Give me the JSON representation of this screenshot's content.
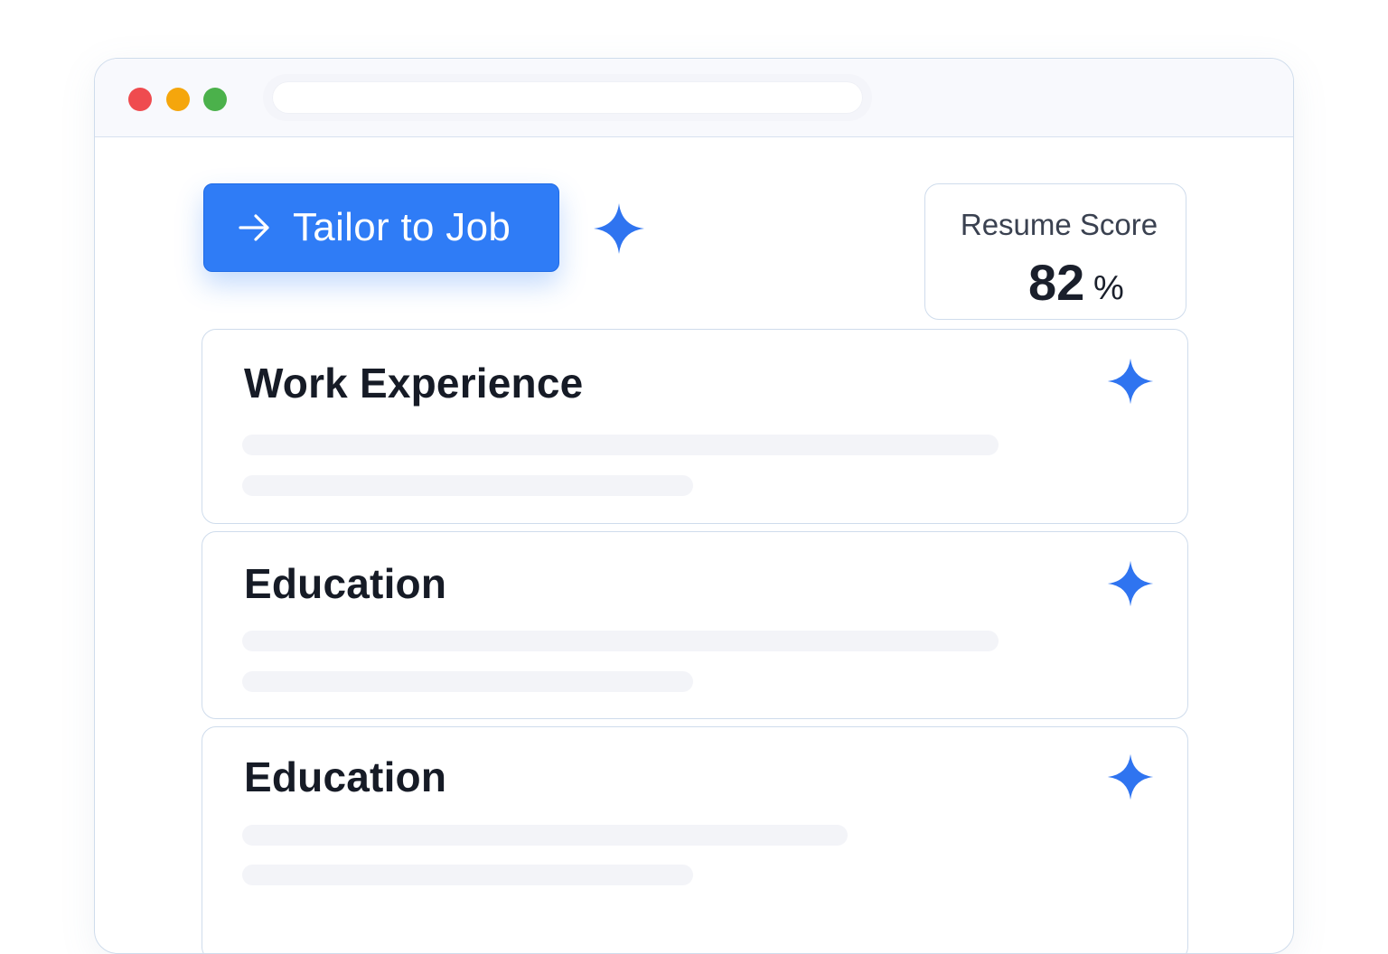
{
  "window": {
    "controls": [
      "close",
      "minimize",
      "maximize"
    ],
    "address_bar": ""
  },
  "toolbar": {
    "tailor_button_label": "Tailor to Job",
    "tailor_button_icon": "arrow-right-icon"
  },
  "score_card": {
    "label": "Resume Score",
    "value": "82",
    "unit": "%"
  },
  "sections": [
    {
      "title": "Work Experience",
      "icon": "sparkle-icon"
    },
    {
      "title": "Education",
      "icon": "sparkle-icon"
    },
    {
      "title": "Education",
      "icon": "sparkle-icon"
    }
  ],
  "colors": {
    "accent": "#2f7cf6",
    "close": "#ef4b4f",
    "minimize": "#f5a60c",
    "maximize": "#4bb14b",
    "border": "#cfdcec",
    "placeholder": "#f3f4f8"
  }
}
